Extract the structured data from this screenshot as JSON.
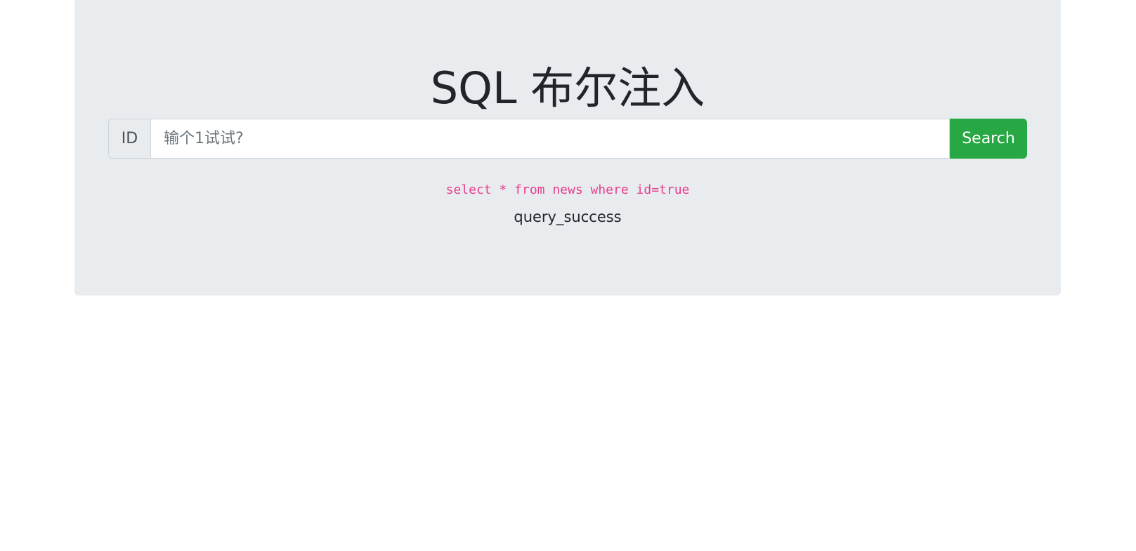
{
  "header": {
    "title": "SQL 布尔注入"
  },
  "search": {
    "prepend_label": "ID",
    "value": "",
    "placeholder": "输个1试试?",
    "button_label": "Search",
    "button_color": "#28a745"
  },
  "result": {
    "query": "select * from news where id=true",
    "status": "query_success"
  },
  "colors": {
    "jumbotron_bg": "#e9ecef",
    "code_color": "#e83e8c"
  }
}
